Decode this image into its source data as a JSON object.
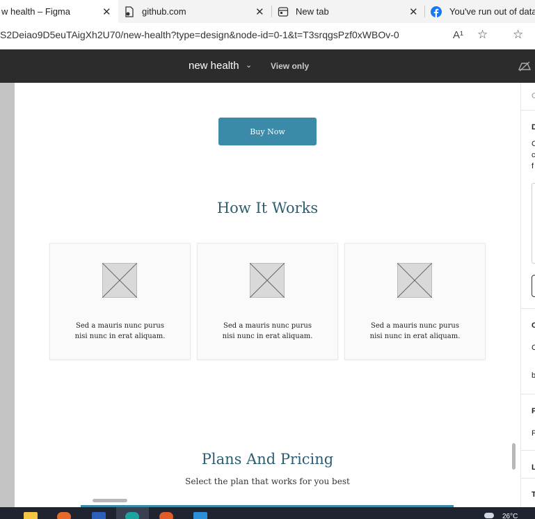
{
  "browser": {
    "tabs": [
      {
        "label": "w health – Figma",
        "active": true,
        "close": "✕"
      },
      {
        "label": "github.com",
        "active": false,
        "close": "✕"
      },
      {
        "label": "New tab",
        "active": false,
        "close": "✕"
      },
      {
        "label": "You've run out of data.",
        "active": false
      }
    ],
    "url": "S2Deiao9D5euTAigXh2U70/new-health?type=design&node-id=0-1&t=T3srqgsPzf0xWBOv-0",
    "icons": {
      "read_aloud": "A¹",
      "favorite": "☆",
      "favorites_bar": "☆"
    }
  },
  "figma": {
    "file_name": "new health",
    "mode": "View only"
  },
  "canvas": {
    "buy_button": "Buy Now",
    "how_title": "How It Works",
    "cards": [
      {
        "line1": "Sed a mauris nunc purus",
        "line2": "nisi nunc in erat aliquam."
      },
      {
        "line1": "Sed a mauris nunc purus",
        "line2": "nisi nunc in erat aliquam."
      },
      {
        "line1": "Sed a mauris nunc purus",
        "line2": "nisi nunc in erat aliquam."
      }
    ],
    "plans_title": "Plans And Pricing",
    "plans_subtitle": "Select the plan that works for you best"
  },
  "right_panel": {
    "letters": [
      "C",
      "D",
      "C",
      "c",
      "f",
      "C",
      "C",
      "b",
      "F",
      "F",
      "L",
      "T"
    ]
  },
  "taskbar": {
    "temp": "26°C"
  },
  "colors": {
    "accent": "#3a8aa8",
    "heading": "#2c5d70",
    "toolbar": "#2c2c2c"
  }
}
